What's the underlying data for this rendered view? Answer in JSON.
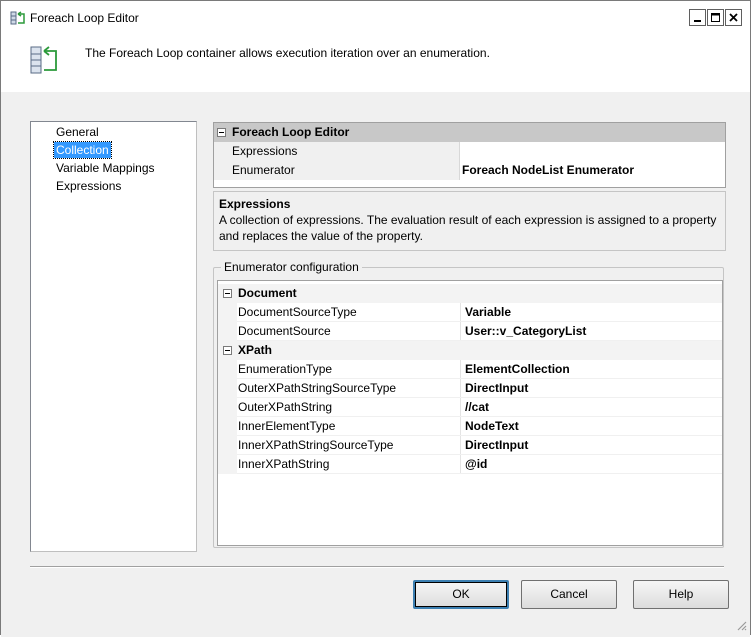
{
  "window": {
    "title": "Foreach Loop Editor",
    "controls": {
      "minimize": "_",
      "maximize": "□",
      "close": "✕"
    }
  },
  "header": {
    "description": "The Foreach Loop container allows execution iteration over an enumeration."
  },
  "nav": {
    "items": [
      {
        "label": "General",
        "selected": false
      },
      {
        "label": "Collection",
        "selected": true
      },
      {
        "label": "Variable Mappings",
        "selected": false
      },
      {
        "label": "Expressions",
        "selected": false
      }
    ]
  },
  "property_grid": {
    "category": "Foreach Loop Editor",
    "rows": [
      {
        "name": "Expressions",
        "value": "",
        "expandable": true
      },
      {
        "name": "Enumerator",
        "value": "Foreach NodeList Enumerator",
        "expandable": false
      }
    ]
  },
  "description_box": {
    "title": "Expressions",
    "body": "A collection of expressions. The evaluation result of each expression is assigned to a property and replaces the value of the property."
  },
  "enumerator_config": {
    "legend": "Enumerator configuration",
    "sections": [
      {
        "name": "Document",
        "rows": [
          {
            "name": "DocumentSourceType",
            "value": "Variable"
          },
          {
            "name": "DocumentSource",
            "value": "User::v_CategoryList"
          }
        ]
      },
      {
        "name": "XPath",
        "rows": [
          {
            "name": "EnumerationType",
            "value": "ElementCollection"
          },
          {
            "name": "OuterXPathStringSourceType",
            "value": "DirectInput"
          },
          {
            "name": "OuterXPathString",
            "value": "//cat"
          },
          {
            "name": "InnerElementType",
            "value": "NodeText"
          },
          {
            "name": "InnerXPathStringSourceType",
            "value": "DirectInput"
          },
          {
            "name": "InnerXPathString",
            "value": "@id"
          }
        ]
      }
    ]
  },
  "buttons": {
    "ok": "OK",
    "cancel": "Cancel",
    "help": "Help"
  },
  "colors": {
    "selection": "#3399ff",
    "category_bg": "#c8c8c8",
    "dialog_bg": "#f0f0f0"
  }
}
